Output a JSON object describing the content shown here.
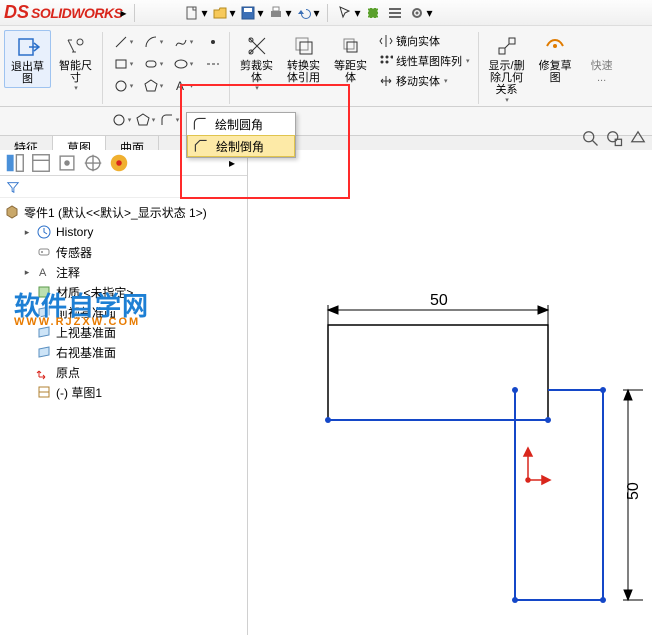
{
  "app": {
    "name": "SOLIDWORKS"
  },
  "ribbon": {
    "exit_sketch": "退出草\n图",
    "smart_dim": "智能尺\n寸",
    "trim": "剪裁实\n体",
    "convert": "转换实\n体引用",
    "offset": "等距实\n体",
    "display_del": "显示/删\n除几何\n关系",
    "repair": "修复草\n图",
    "quick": "快速\n...",
    "mirror": "镜向实体",
    "linear_pattern": "线性草图阵列",
    "move": "移动实体"
  },
  "dropdown": {
    "fillet": "绘制圆角",
    "chamfer": "绘制倒角"
  },
  "tabs": {
    "feature": "特征",
    "sketch": "草图",
    "surface": "曲面"
  },
  "tree": {
    "root": "零件1 (默认<<默认>_显示状态 1>)",
    "history": "History",
    "sensors": "传感器",
    "annotations": "注释",
    "material": "材质 <未指定>",
    "front": "前视基准面",
    "top": "上视基准面",
    "right": "右视基准面",
    "origin": "原点",
    "sketch1": "(-) 草图1"
  },
  "watermark": {
    "main": "软件自学网",
    "sub": "WWW.RJZXW.COM"
  },
  "canvas": {
    "dim_h": "50",
    "dim_v": "50"
  },
  "colors": {
    "accent": "#1d7fd4",
    "sketch_blue": "#1447c8",
    "dim_black": "#000",
    "red": "#d9261c"
  }
}
